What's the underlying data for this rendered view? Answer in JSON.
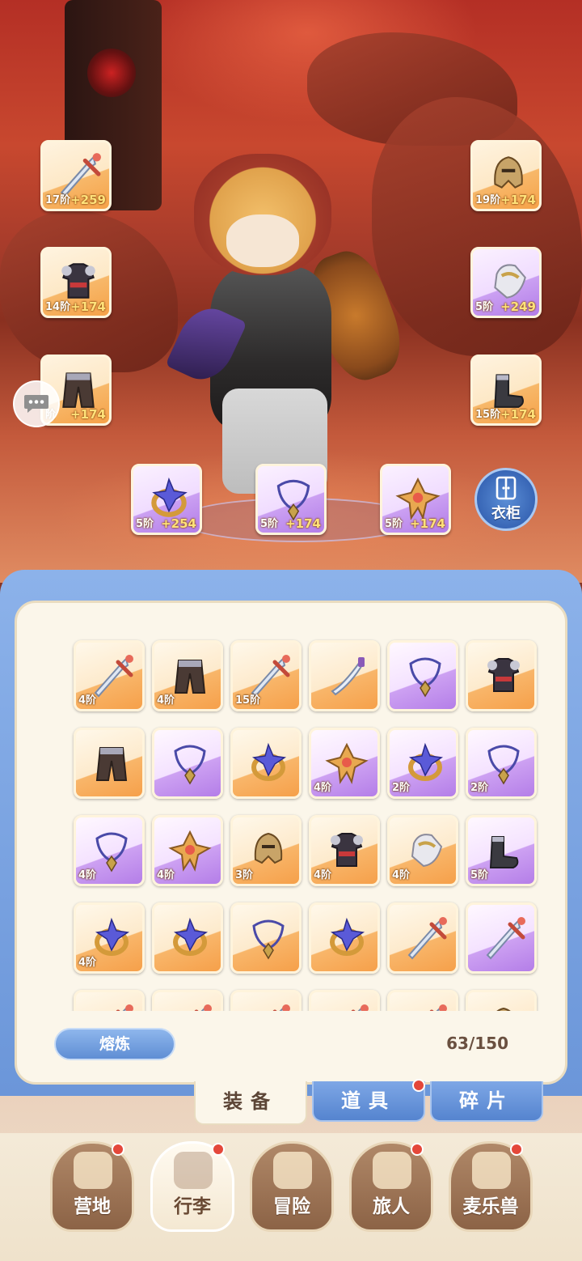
{
  "equipped": [
    {
      "slot": "weapon",
      "tier": "17阶",
      "bonus": "+259",
      "rarity": "gold",
      "icon": "sword-icon"
    },
    {
      "slot": "helmet",
      "tier": "19阶",
      "bonus": "+174",
      "rarity": "gold",
      "icon": "helmet-icon"
    },
    {
      "slot": "armor",
      "tier": "14阶",
      "bonus": "+174",
      "rarity": "gold",
      "icon": "armor-icon"
    },
    {
      "slot": "gauntlet",
      "tier": "5阶",
      "bonus": "+249",
      "rarity": "purple",
      "icon": "gauntlet-icon"
    },
    {
      "slot": "pants",
      "tier": "阶",
      "bonus": "+174",
      "rarity": "gold",
      "icon": "pants-icon"
    },
    {
      "slot": "boots",
      "tier": "15阶",
      "bonus": "+174",
      "rarity": "gold",
      "icon": "boots-icon"
    },
    {
      "slot": "ring",
      "tier": "5阶",
      "bonus": "+254",
      "rarity": "purple",
      "icon": "ring-icon"
    },
    {
      "slot": "necklace",
      "tier": "5阶",
      "bonus": "+174",
      "rarity": "purple",
      "icon": "necklace-icon"
    },
    {
      "slot": "amulet",
      "tier": "5阶",
      "bonus": "+174",
      "rarity": "purple",
      "icon": "amulet-icon"
    }
  ],
  "wardrobe_label": "衣柜",
  "bag": {
    "items": [
      {
        "tier": "4阶",
        "rarity": "gold",
        "icon": "sword-icon"
      },
      {
        "tier": "4阶",
        "rarity": "gold",
        "icon": "pants-icon"
      },
      {
        "tier": "15阶",
        "rarity": "gold",
        "icon": "sword-icon"
      },
      {
        "tier": "",
        "rarity": "gold",
        "icon": "dagger-icon"
      },
      {
        "tier": "",
        "rarity": "purple",
        "icon": "necklace-icon"
      },
      {
        "tier": "",
        "rarity": "gold",
        "icon": "armor-icon"
      },
      {
        "tier": "",
        "rarity": "gold",
        "icon": "pants-icon"
      },
      {
        "tier": "",
        "rarity": "purple",
        "icon": "necklace-icon"
      },
      {
        "tier": "",
        "rarity": "gold",
        "icon": "ring-icon"
      },
      {
        "tier": "4阶",
        "rarity": "purple",
        "icon": "amulet-icon"
      },
      {
        "tier": "2阶",
        "rarity": "purple",
        "icon": "ring-icon"
      },
      {
        "tier": "2阶",
        "rarity": "purple",
        "icon": "necklace-icon"
      },
      {
        "tier": "4阶",
        "rarity": "purple",
        "icon": "necklace-icon"
      },
      {
        "tier": "4阶",
        "rarity": "purple",
        "icon": "amulet-icon"
      },
      {
        "tier": "3阶",
        "rarity": "gold",
        "icon": "helmet-icon"
      },
      {
        "tier": "4阶",
        "rarity": "gold",
        "icon": "armor-icon"
      },
      {
        "tier": "4阶",
        "rarity": "gold",
        "icon": "gauntlet-icon"
      },
      {
        "tier": "5阶",
        "rarity": "purple",
        "icon": "boots-icon"
      },
      {
        "tier": "4阶",
        "rarity": "gold",
        "icon": "ring-icon"
      },
      {
        "tier": "",
        "rarity": "gold",
        "icon": "ring-icon"
      },
      {
        "tier": "",
        "rarity": "gold",
        "icon": "necklace-icon"
      },
      {
        "tier": "",
        "rarity": "gold",
        "icon": "ring-icon"
      },
      {
        "tier": "",
        "rarity": "gold",
        "icon": "sword-icon"
      },
      {
        "tier": "",
        "rarity": "purple",
        "icon": "sword-icon"
      },
      {
        "tier": "",
        "rarity": "gold",
        "icon": "sword-icon"
      },
      {
        "tier": "",
        "rarity": "gold",
        "icon": "sword-icon"
      },
      {
        "tier": "",
        "rarity": "gold",
        "icon": "sword-icon"
      },
      {
        "tier": "",
        "rarity": "gold",
        "icon": "sword-icon"
      },
      {
        "tier": "",
        "rarity": "gold",
        "icon": "sword-icon"
      },
      {
        "tier": "",
        "rarity": "gold",
        "icon": "helmet-icon"
      }
    ],
    "smelt_label": "熔炼",
    "capacity": "63/150"
  },
  "tabs": [
    {
      "label": "装备",
      "active": true,
      "badge": false
    },
    {
      "label": "道具",
      "active": false,
      "badge": true
    },
    {
      "label": "碎片",
      "active": false,
      "badge": false
    }
  ],
  "nav": [
    {
      "label": "营地",
      "active": false,
      "badge": true,
      "icon": "castle-icon"
    },
    {
      "label": "行李",
      "active": true,
      "badge": true,
      "icon": "backpack-icon"
    },
    {
      "label": "冒险",
      "active": false,
      "badge": false,
      "icon": "crossed-swords-icon"
    },
    {
      "label": "旅人",
      "active": false,
      "badge": true,
      "icon": "traveler-icon"
    },
    {
      "label": "麦乐兽",
      "active": false,
      "badge": true,
      "icon": "pet-icon"
    }
  ],
  "colors": {
    "accent_blue": "#6b96d9",
    "gold_rarity": "#f6a248",
    "purple_rarity": "#b27de8",
    "badge_red": "#e4473a"
  }
}
